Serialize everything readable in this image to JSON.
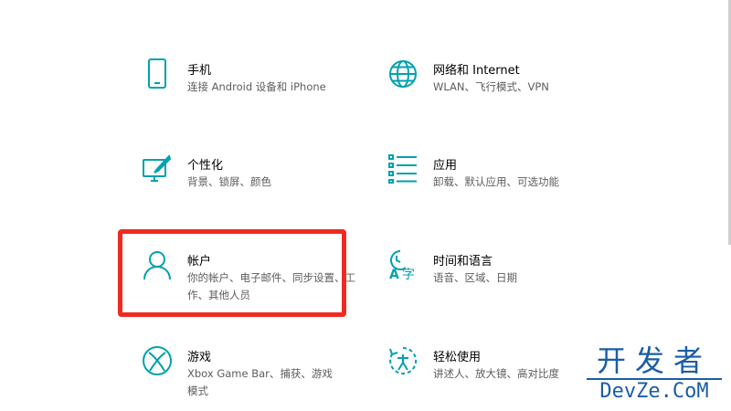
{
  "settings": {
    "accent_color": "#00a1b0",
    "tiles": [
      {
        "title": "手机",
        "desc": "连接 Android 设备和 iPhone",
        "icon": "phone-icon"
      },
      {
        "title": "网络和 Internet",
        "desc": "WLAN、飞行模式、VPN",
        "icon": "globe-icon"
      },
      {
        "title": "个性化",
        "desc": "背景、锁屏、颜色",
        "icon": "personalization-icon"
      },
      {
        "title": "应用",
        "desc": "卸载、默认应用、可选功能",
        "icon": "apps-list-icon"
      },
      {
        "title": "帐户",
        "desc": "你的帐户、电子邮件、同步设置、工作、其他人员",
        "icon": "person-icon"
      },
      {
        "title": "时间和语言",
        "desc": "语音、区域、日期",
        "icon": "time-language-icon"
      },
      {
        "title": "游戏",
        "desc": "Xbox Game Bar、捕获、游戏模式",
        "icon": "xbox-icon"
      },
      {
        "title": "轻松使用",
        "desc": "讲述人、放大镜、高对比度",
        "icon": "ease-of-access-icon"
      }
    ],
    "highlight_color": "#ef2b21"
  },
  "watermark": {
    "cn": "开发者",
    "en": "DevZe.CoM"
  }
}
